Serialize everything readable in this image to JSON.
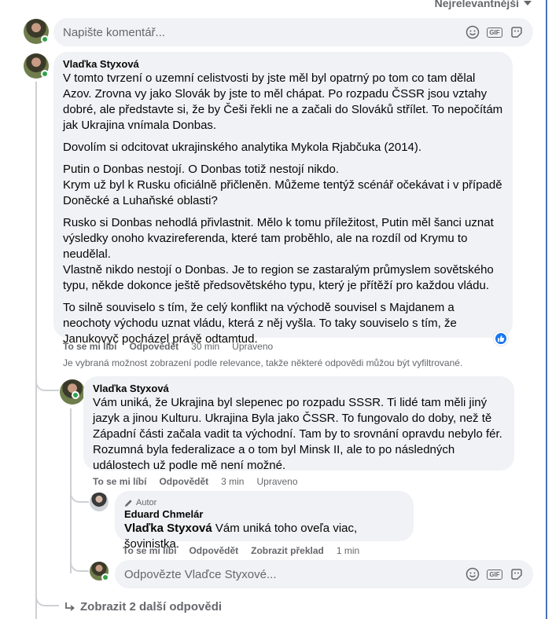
{
  "sort": {
    "label": "Nejrelevantnější"
  },
  "comment_input": {
    "placeholder": "Napište komentář..."
  },
  "main_comment": {
    "author": "Vlaďka Styxová",
    "paragraphs": [
      "V tomto tvrzení o uzemní celistvosti by jste měl byl opatrný po tom co tam dělal Azov. Zrovna vy jako Slovák by jste to měl chápat. Po rozpadu ČSSR jsou vztahy dobré, ale představte si, že by Češi řekli ne a začali do Slováků střílet. To nepočítám jak Ukrajina vnímala Donbas.",
      "Dovolím si odcitovat ukrajinského analytika Mykola Rjabčuka (2014).",
      "Putin o Donbas nestojí. O Donbas totiž nestojí nikdo.\nKrym už byl k Rusku oficiálně přičleněn. Můžeme tentýž scénář očekávat i v případě Doněcké a Luhaňské oblasti?",
      "Rusko si Donbas nehodlá přivlastnit. Mělo k tomu příležitost, Putin měl šanci uznat výsledky onoho kvazireferenda, které tam proběhlo, ale na rozdíl od Krymu to neudělal.\nVlastně nikdo nestojí o Donbas. Je to region se zastaralým průmyslem sovětského typu, někde dokonce ještě předsovětského typu, který je přítěží pro každou vládu.",
      "To silně souviselo s tím, že celý konflikt na východě souvisel s Majdanem a neochoty východu uznat vládu, která z něj vyšla. To taky souviselo s tím, že Janukovyč pocházel právě odtamtud."
    ],
    "actions": {
      "like": "To se mi líbí",
      "reply": "Odpovědět",
      "time": "30 min",
      "edited": "Upraveno"
    }
  },
  "filter_note": "Je vybraná možnost zobrazení podle relevance, takže některé odpovědi můžou být vyfiltrované.",
  "reply1": {
    "author": "Vlaďka Styxová",
    "text": "Vám uniká, že Ukrajina byl slepenec po rozpadu SSSR. Ti lidé tam měli jiný jazyk a jinou Kulturu. Ukrajina Byla jako ČSSR. To fungovalo do doby, než tě Západní části začala vadit ta východní. Tam by to srovnání opravdu nebylo fér. Rozumná byla federalizace a o tom byl Minsk II, ale to po následných událostech už podle mě není možné.",
    "actions": {
      "like": "To se mi líbí",
      "reply": "Odpovědět",
      "time": "3 min",
      "edited": "Upraveno"
    }
  },
  "reply2": {
    "author_tag": "Autor",
    "author": "Eduard Chmelár",
    "mention": "Vlaďka Styxová",
    "text": " Vám uniká toho oveľa viac, šovinistka.",
    "actions": {
      "like": "To se mi líbí",
      "reply": "Odpovědět",
      "translate": "Zobrazit překlad",
      "time": "1 min"
    }
  },
  "reply_input": {
    "placeholder": "Odpovězte Vlaďce Styxové..."
  },
  "more_replies": {
    "label": "Zobrazit 2 další odpovědi"
  },
  "colors": {
    "accent": "#1877f2",
    "online": "#31a24c",
    "bubble": "#f0f2f5",
    "frame": "#4b73b8"
  }
}
